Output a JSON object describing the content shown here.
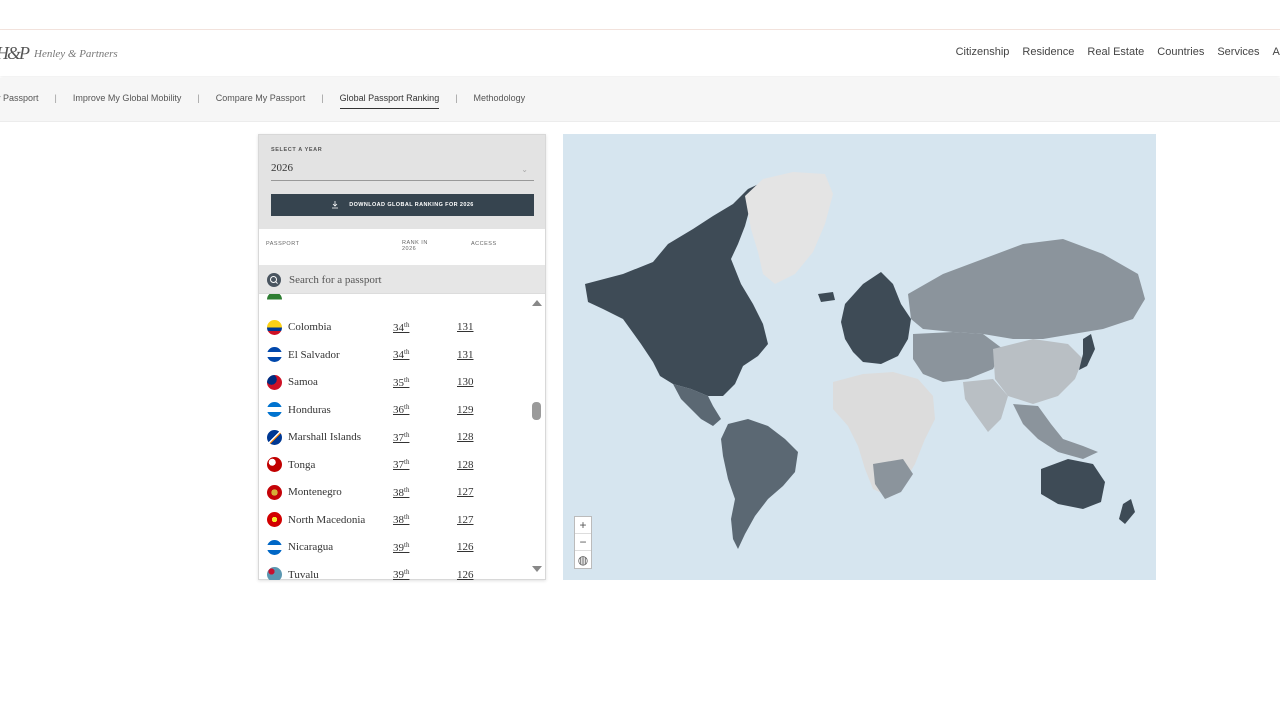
{
  "header": {
    "logo_mark": "H&P",
    "logo_text": "Henley & Partners",
    "nav": [
      "Citizenship",
      "Residence",
      "Real Estate",
      "Countries",
      "Services",
      "Ab"
    ]
  },
  "subnav": {
    "items": [
      "y Passport",
      "Improve My Global Mobility",
      "Compare My Passport",
      "Global Passport Ranking",
      "Methodology"
    ],
    "active": "Global Passport Ranking"
  },
  "panel": {
    "year_label": "SELECT A YEAR",
    "year_value": "2026",
    "download_label": "DOWNLOAD GLOBAL RANKING FOR 2026",
    "columns": {
      "passport": "PASSPORT",
      "rank": "RANK IN 2026",
      "access": "ACCESS"
    },
    "search_placeholder": "Search for a passport",
    "rows": [
      {
        "name": "",
        "rank": "",
        "rank_suffix": "",
        "access": ""
      },
      {
        "name": "Colombia",
        "rank": "34",
        "rank_suffix": "th",
        "access": "131"
      },
      {
        "name": "El Salvador",
        "rank": "34",
        "rank_suffix": "th",
        "access": "131"
      },
      {
        "name": "Samoa",
        "rank": "35",
        "rank_suffix": "th",
        "access": "130"
      },
      {
        "name": "Honduras",
        "rank": "36",
        "rank_suffix": "th",
        "access": "129"
      },
      {
        "name": "Marshall Islands",
        "rank": "37",
        "rank_suffix": "th",
        "access": "128"
      },
      {
        "name": "Tonga",
        "rank": "37",
        "rank_suffix": "th",
        "access": "128"
      },
      {
        "name": "Montenegro",
        "rank": "38",
        "rank_suffix": "th",
        "access": "127"
      },
      {
        "name": "North Macedonia",
        "rank": "38",
        "rank_suffix": "th",
        "access": "127"
      },
      {
        "name": "Nicaragua",
        "rank": "39",
        "rank_suffix": "th",
        "access": "126"
      },
      {
        "name": "Tuvalu",
        "rank": "39",
        "rank_suffix": "th",
        "access": "126"
      }
    ]
  },
  "map": {
    "zoom_in": "+",
    "zoom_out": "−",
    "reset": "◍",
    "colors": {
      "ocean": "#d6e5ef",
      "high": "#3e4b56",
      "mid_high": "#5b6873",
      "mid": "#8b949c",
      "low": "#b9bfc4",
      "lowest": "#dcdcdc"
    }
  }
}
